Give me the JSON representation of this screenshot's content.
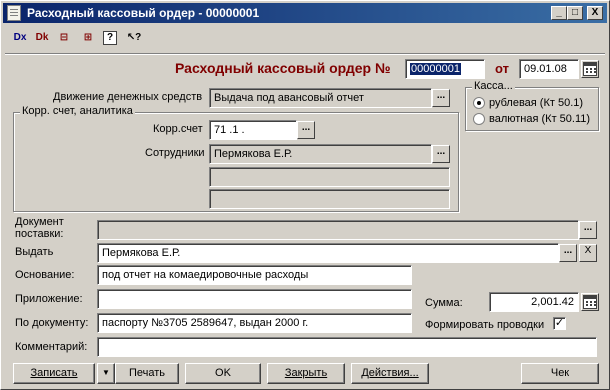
{
  "window": {
    "title": "Расходный кассовый ордер - 00000001",
    "minimize": "_",
    "maximize": "□",
    "close": "X"
  },
  "toolbar": [
    {
      "icon": "document-x-icon",
      "glyph": "Dx"
    },
    {
      "icon": "document-kt-icon",
      "glyph": "Dk"
    },
    {
      "icon": "journal-icon",
      "glyph": "⊟"
    },
    {
      "icon": "structure-icon",
      "glyph": "⊞"
    },
    {
      "icon": "help-icon",
      "glyph": "?"
    },
    {
      "icon": "context-help-icon",
      "glyph": "↖?"
    }
  ],
  "header": {
    "doc_title": "Расходный кассовый ордер №",
    "number": "00000001",
    "date_label": "от",
    "date": "09.01.08",
    "title_color": "#800000"
  },
  "movement": {
    "label": "Движение денежных средств",
    "value": "Выдача под авансовый отчет",
    "ellipsis": "..."
  },
  "cash": {
    "legend": "Касса...",
    "options": [
      {
        "label": "рублевая (Кт 50.1)",
        "selected": true
      },
      {
        "label": "валютная (Кт 50.11)",
        "selected": false
      }
    ]
  },
  "corr": {
    "legend": "Корр. счет, аналитика",
    "account_label": "Корр.счет",
    "account_value": "71 .1 .",
    "employees_label": "Сотрудники",
    "employees_value": "Пермякова Е.Р.",
    "extra1": "",
    "extra2": ""
  },
  "delivery": {
    "label": "Документ\nпоставки:",
    "value": ""
  },
  "issue": {
    "label": "Выдать",
    "value": "Пермякова Е.Р.",
    "clear": "X"
  },
  "basis": {
    "label": "Основание:",
    "value": "под отчет на комаедировочные расходы"
  },
  "attachment": {
    "label": "Приложение:",
    "value": ""
  },
  "sum": {
    "label": "Сумма:",
    "value": "2,001.42"
  },
  "by_document": {
    "label": "По документу:",
    "value": "паспорту  №3705 2589647, выдан  2000 г."
  },
  "postings": {
    "label": "Формировать проводки",
    "checked": true,
    "mark": "✓"
  },
  "comment": {
    "label": "Комментарий:",
    "value": ""
  },
  "buttons": {
    "save": "Записать",
    "dropdown": "▼",
    "print": "Печать",
    "ok": "OK",
    "close": "Закрыть",
    "actions": "Действия...",
    "receipt": "Чек"
  }
}
